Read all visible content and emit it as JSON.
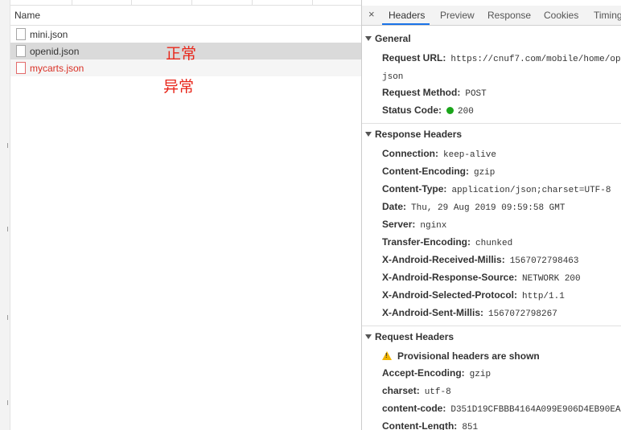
{
  "request_list": {
    "column_header": "Name",
    "items": [
      {
        "name": "mini.json",
        "status": "ok"
      },
      {
        "name": "openid.json",
        "status": "selected"
      },
      {
        "name": "mycarts.json",
        "status": "error"
      }
    ]
  },
  "annotations": {
    "normal": "正常",
    "abnormal": "异常"
  },
  "details": {
    "close_icon": "×",
    "tabs": [
      {
        "label": "Headers",
        "active": true
      },
      {
        "label": "Preview",
        "active": false
      },
      {
        "label": "Response",
        "active": false
      },
      {
        "label": "Cookies",
        "active": false
      },
      {
        "label": "Timing",
        "active": false
      }
    ],
    "general": {
      "title": "General",
      "request_url_key": "Request URL:",
      "request_url_value": "https://cnuf7.com/mobile/home/ope",
      "request_url_wrap": "json",
      "request_method_key": "Request Method:",
      "request_method_value": "POST",
      "status_code_key": "Status Code:",
      "status_code_value": "200"
    },
    "response_headers": {
      "title": "Response Headers",
      "items": [
        {
          "key": "Connection:",
          "value": "keep-alive"
        },
        {
          "key": "Content-Encoding:",
          "value": "gzip"
        },
        {
          "key": "Content-Type:",
          "value": "application/json;charset=UTF-8"
        },
        {
          "key": "Date:",
          "value": "Thu, 29 Aug 2019 09:59:58 GMT"
        },
        {
          "key": "Server:",
          "value": "nginx"
        },
        {
          "key": "Transfer-Encoding:",
          "value": "chunked"
        },
        {
          "key": "X-Android-Received-Millis:",
          "value": "1567072798463"
        },
        {
          "key": "X-Android-Response-Source:",
          "value": "NETWORK 200"
        },
        {
          "key": "X-Android-Selected-Protocol:",
          "value": "http/1.1"
        },
        {
          "key": "X-Android-Sent-Millis:",
          "value": "1567072798267"
        }
      ]
    },
    "request_headers": {
      "title": "Request Headers",
      "warning": "Provisional headers are shown",
      "items": [
        {
          "key": "Accept-Encoding:",
          "value": "gzip"
        },
        {
          "key": "charset:",
          "value": "utf-8"
        },
        {
          "key": "content-code:",
          "value": "D351D19CFBBB4164A099E906D4EB90EA"
        },
        {
          "key": "Content-Length:",
          "value": "851"
        }
      ]
    },
    "colors": {
      "active_tab": "#1a73e8",
      "error_text": "#d93025",
      "annotation": "#e8261a",
      "status_dot": "#1aa51a"
    }
  }
}
